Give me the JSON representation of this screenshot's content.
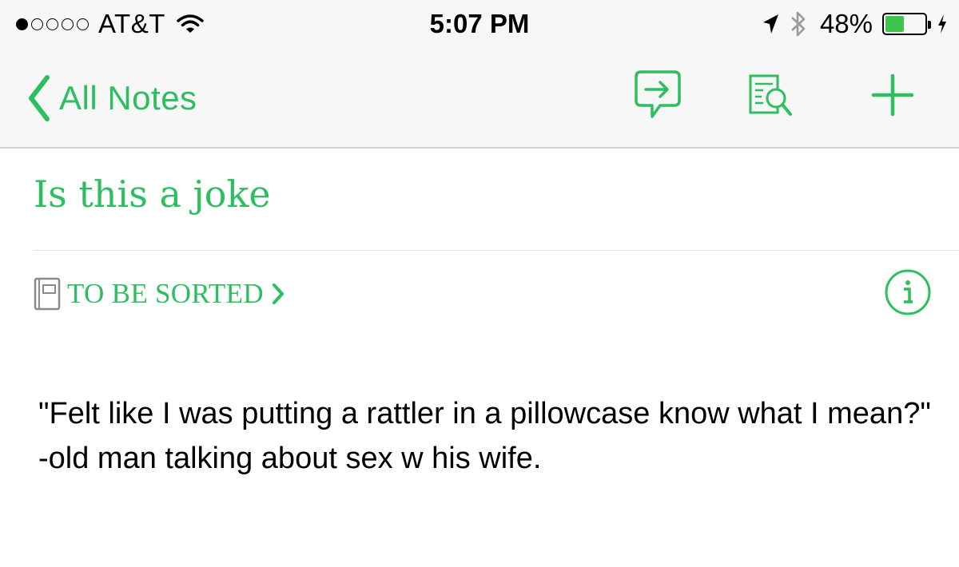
{
  "status_bar": {
    "signal_dots": {
      "filled": 1,
      "total": 5
    },
    "carrier": "AT&T",
    "time": "5:07 PM",
    "battery_percent_label": "48%",
    "battery_level": 0.48,
    "icons": [
      "wifi-icon",
      "location-arrow-icon",
      "bluetooth-icon",
      "battery-icon",
      "charging-bolt-icon"
    ]
  },
  "nav": {
    "back_label": "All Notes",
    "actions": [
      "share-icon",
      "note-search-icon",
      "add-note-icon"
    ]
  },
  "note": {
    "title": "Is this a joke",
    "notebook": "TO BE SORTED",
    "body": "\"Felt like I was putting a rattler in a pillowcase know what I mean?\" -old man talking about sex w his wife."
  },
  "colors": {
    "accent": "#2dbe60",
    "battery_fill": "#3fc44c",
    "bar_background": "#f7f7f7"
  }
}
